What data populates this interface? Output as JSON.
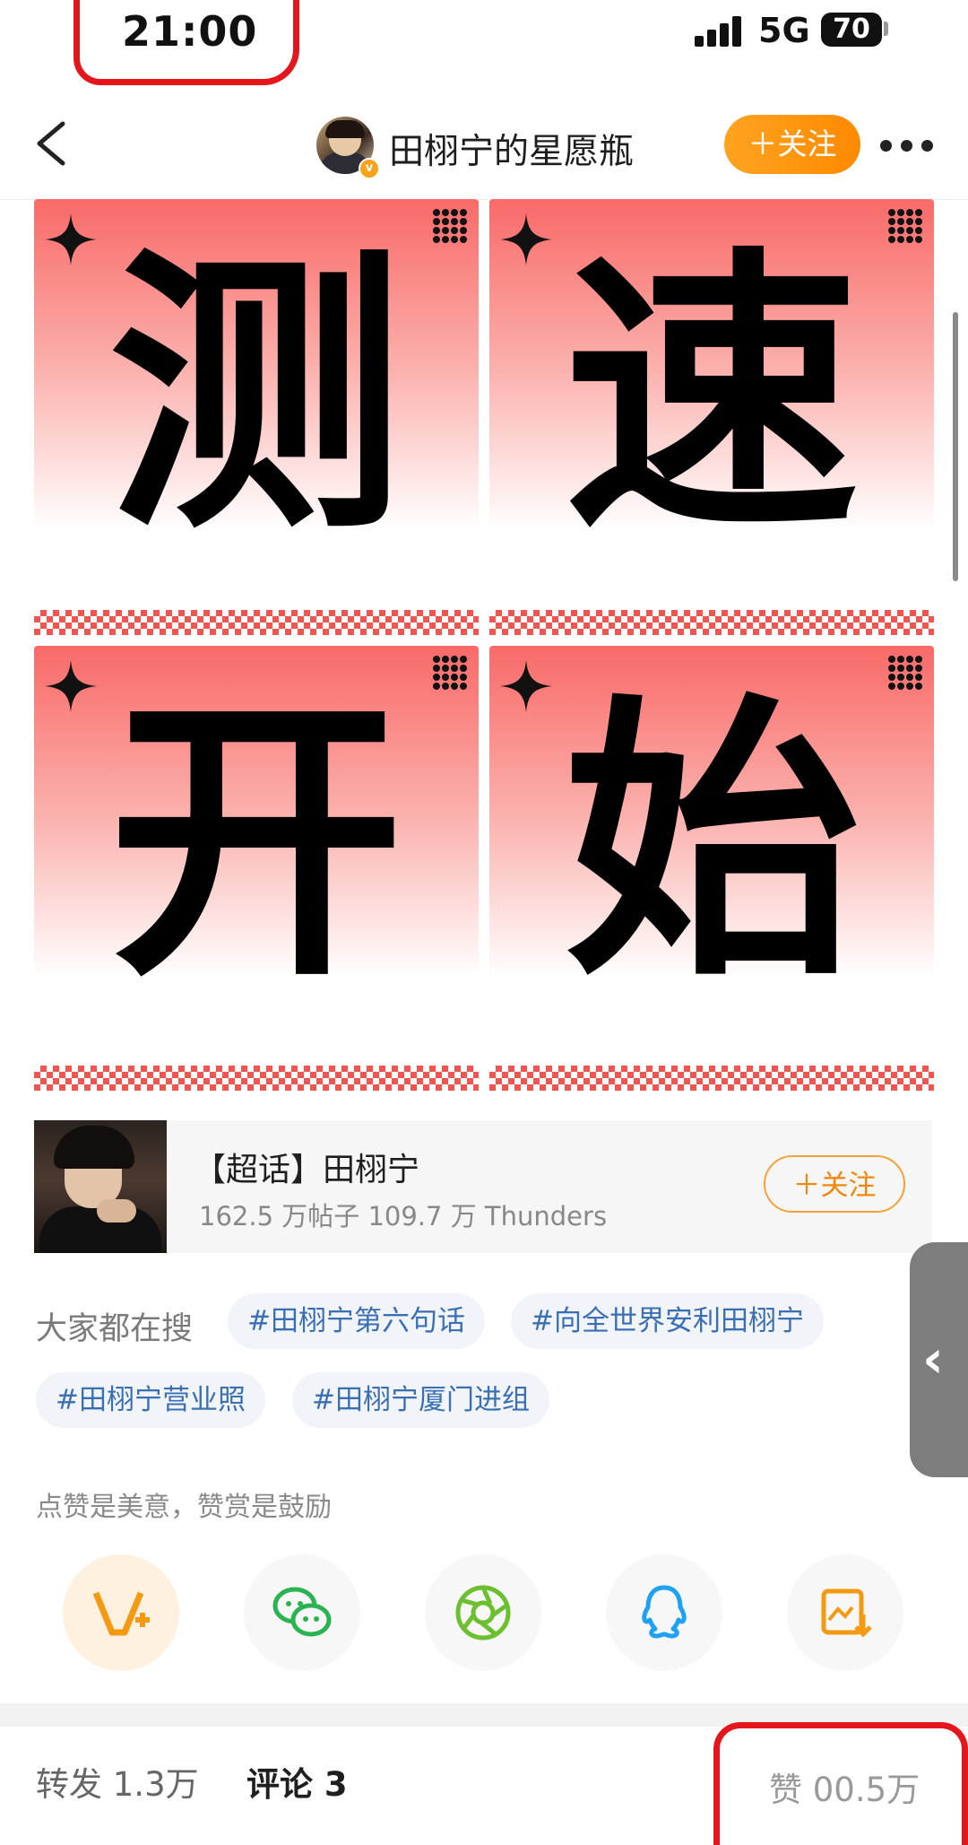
{
  "status_bar": {
    "time": "21:00",
    "network": "5G",
    "battery": "70"
  },
  "nav": {
    "back_icon": "chevron-left-icon",
    "title": "田栩宁的星愿瓶",
    "follow_label": "＋关注",
    "more_icon": "more-dots-icon"
  },
  "post_image": {
    "tiles": [
      "测",
      "速",
      "开",
      "始"
    ]
  },
  "super_topic": {
    "title": "【超话】田栩宁",
    "stats": "162.5 万帖子 109.7 万 Thunders",
    "follow_label": "＋关注"
  },
  "side_tab": {
    "icon": "chevron-left-icon",
    "glyph": "‹"
  },
  "search": {
    "label": "大家都在搜",
    "tags": [
      "#田栩宁第六句话",
      "#向全世界安利田栩宁",
      "#田栩宁营业照",
      "#田栩宁厦门进组"
    ]
  },
  "reward": {
    "hint": "点赞是美意，赞赏是鼓励"
  },
  "share_icons": [
    "reward-v-plus-icon",
    "wechat-icon",
    "moments-icon",
    "qq-icon",
    "save-image-icon"
  ],
  "colors": {
    "accent_orange": "#ff9000",
    "tile_red": "#f86a68",
    "tag_blue": "#3b6fb3",
    "annotation_red": "#e4161c"
  },
  "bottom_bar": {
    "repost": "转发 1.3万",
    "comments": "评论 3",
    "likes": "赞 00.5万"
  }
}
